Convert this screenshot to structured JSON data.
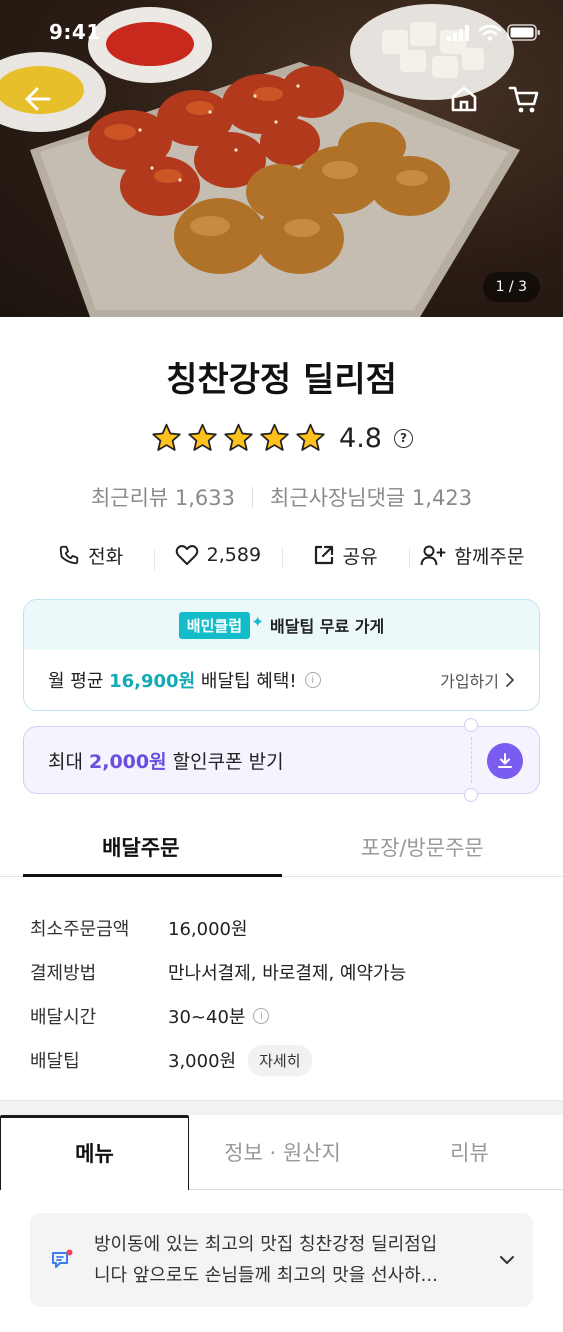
{
  "status_bar": {
    "time": "9:41"
  },
  "hero": {
    "image_counter": "1 / 3"
  },
  "store": {
    "name": "칭찬강정 딜리점",
    "rating": "4.8",
    "rating_stars": 5,
    "help_icon_text": "?",
    "recent_reviews": "최근리뷰 1,633",
    "owner_replies": "최근사장님댓글 1,423"
  },
  "actions": [
    {
      "icon": "phone-icon",
      "label": "전화"
    },
    {
      "icon": "heart-icon",
      "label": "2,589"
    },
    {
      "icon": "share-icon",
      "label": "공유"
    },
    {
      "icon": "add-user-icon",
      "label": "함께주문"
    }
  ],
  "club": {
    "badge": "배민클럽",
    "title": "배달팁 무료 가게",
    "benefit_prefix": "월 평균 ",
    "benefit_amount": "16,900원",
    "benefit_suffix": " 배달팁 혜택!",
    "join_label": "가입하기",
    "accent_color": "#12bdc9"
  },
  "coupon": {
    "prefix": "최대 ",
    "amount": "2,000원",
    "suffix": " 할인쿠폰 받기",
    "accent_color": "#7a5cf0"
  },
  "order_tabs": {
    "delivery": "배달주문",
    "pickup": "포장/방문주문"
  },
  "delivery_info": {
    "min_order_label": "최소주문금액",
    "min_order_value": "16,000원",
    "payment_label": "결제방법",
    "payment_value": "만나서결제, 바로결제, 예약가능",
    "time_label": "배달시간",
    "time_value": "30~40분",
    "tip_label": "배달팁",
    "tip_value": "3,000원",
    "detail_button": "자세히"
  },
  "menu_tabs": {
    "menu": "메뉴",
    "info": "정보 · 원산지",
    "review": "리뷰"
  },
  "notice": {
    "line1": "방이동에 있는 최고의 맛집 칭찬강정 딜리점입",
    "line2": "니다 앞으로도 손님들께 최고의 맛을 선사하..."
  }
}
